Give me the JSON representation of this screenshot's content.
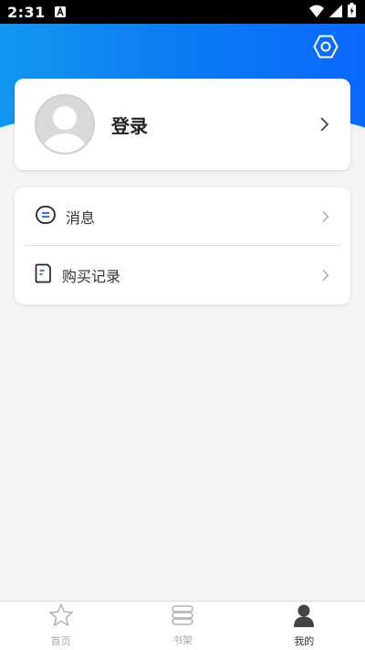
{
  "status_bar": {
    "time": "2:31"
  },
  "profile": {
    "login_label": "登录"
  },
  "menu": {
    "items": [
      {
        "label": "消息",
        "icon": "message-icon"
      },
      {
        "label": "购买记录",
        "icon": "document-icon"
      }
    ]
  },
  "tabbar": {
    "tabs": [
      {
        "label": "首页",
        "icon": "star-icon",
        "active": false
      },
      {
        "label": "书架",
        "icon": "bookshelf-icon",
        "active": false
      },
      {
        "label": "我的",
        "icon": "person-icon",
        "active": true
      }
    ]
  },
  "colors": {
    "header_start": "#1297f0",
    "header_end": "#0a68ff",
    "background": "#f4f4f4"
  }
}
